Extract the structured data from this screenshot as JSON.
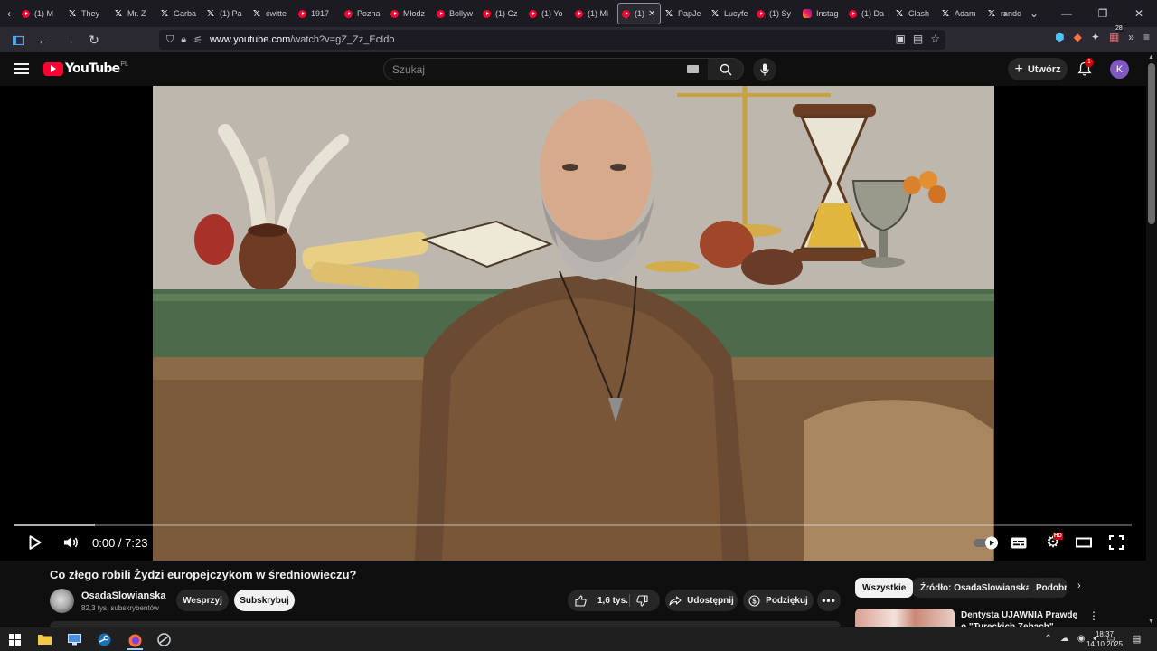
{
  "browser": {
    "tabs": [
      {
        "icon": "yt",
        "label": "(1) M"
      },
      {
        "icon": "x",
        "label": "They"
      },
      {
        "icon": "x",
        "label": "Mr. Z"
      },
      {
        "icon": "x",
        "label": "Garba"
      },
      {
        "icon": "x",
        "label": "(1) Pa"
      },
      {
        "icon": "x",
        "label": "ćwitte"
      },
      {
        "icon": "yt",
        "label": "1917"
      },
      {
        "icon": "yt",
        "label": "Pozna"
      },
      {
        "icon": "yt",
        "label": "Młodz"
      },
      {
        "icon": "yt",
        "label": "Bollyw"
      },
      {
        "icon": "yt",
        "label": "(1) Cz"
      },
      {
        "icon": "yt",
        "label": "(1) Yo"
      },
      {
        "icon": "yt",
        "label": "(1) Mi"
      },
      {
        "icon": "yt",
        "label": "(1)",
        "active": true
      },
      {
        "icon": "x",
        "label": "PapJe"
      },
      {
        "icon": "x",
        "label": "Lucyfe"
      },
      {
        "icon": "yt",
        "label": "(1) Sy"
      },
      {
        "icon": "ig",
        "label": "Instag"
      },
      {
        "icon": "yt",
        "label": "(1) Da"
      },
      {
        "icon": "x",
        "label": "Clash"
      },
      {
        "icon": "x",
        "label": "Adam"
      },
      {
        "icon": "x",
        "label": "rando"
      }
    ],
    "url_host": "www.youtube.com",
    "url_path": "/watch?v=gZ_Zz_EcIdo",
    "extension_badge": "28"
  },
  "youtube": {
    "logo_text": "YouTube",
    "country_code": "PL",
    "search_placeholder": "Szukaj",
    "create_label": "Utwórz",
    "notification_count": "1",
    "avatar_letter": "K"
  },
  "player": {
    "current_time": "0:00",
    "duration": "7:23",
    "time_display": "0:00 / 7:23",
    "buffered_fraction": 0.072,
    "quality_badge": "HD"
  },
  "video": {
    "title": "Co złego robili Żydzi europejczykom w średniowieczu?",
    "channel_name": "OsadaSlowianska",
    "subscribers": "82,3 tys. subskrybentów",
    "join_label": "Wesprzyj",
    "subscribe_label": "Subskrybuj",
    "likes": "1,6 tys.",
    "share_label": "Udostępnij",
    "thanks_label": "Podziękuj"
  },
  "sidebar": {
    "chips": [
      "Wszystkie",
      "Źródło: OsadaSlowianska",
      "Podobne"
    ],
    "recommendation_title": "Dentysta UJAWNIA Prawdę o \"Tureckich Zębach\". Zobacz"
  },
  "taskbar": {
    "time": "18:37",
    "date": "14.10.2025"
  }
}
